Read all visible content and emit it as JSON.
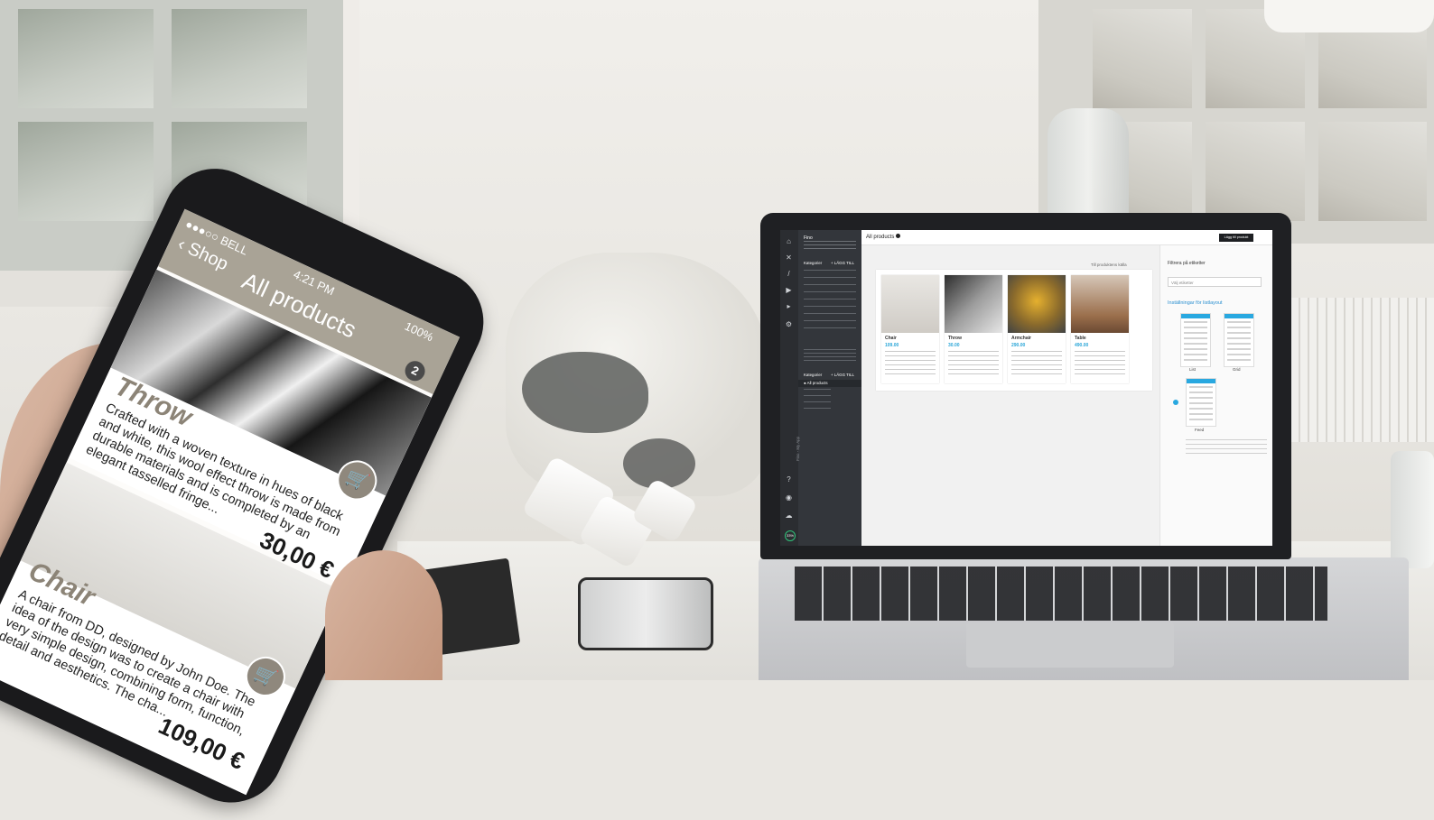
{
  "phone_app": {
    "status": {
      "carrier": "●●●○○ BELL",
      "time": "4:21 PM",
      "battery": "100%"
    },
    "back_label": "Shop",
    "title": "All products",
    "cart_count": "2",
    "products": [
      {
        "name": "Throw",
        "description": "Crafted with a woven texture in hues of black and white, this wool effect throw is made from durable materials and is completed by an elegant tasselled fringe...",
        "price": "30,00 €"
      },
      {
        "name": "Chair",
        "description": "A chair from DD, designed by John Doe. The idea of the design was to create a chair with very simple design, combining form, function, detail and aesthetics. The cha...",
        "price": "109,00 €"
      }
    ]
  },
  "laptop_app": {
    "page_title": "All products",
    "header_button": "Lägg till produkt",
    "sidebar": {
      "shop_title": "Fino",
      "section_categories": "Kategorier",
      "add_label": "+ LÄGG TILL",
      "active_item": "All products",
      "side_text": "Fino - My App",
      "progress": "33%"
    },
    "content_link": "Till produktens källa",
    "cards": [
      {
        "name": "Chair",
        "price": "109.00"
      },
      {
        "name": "Throw",
        "price": "30.00"
      },
      {
        "name": "Armchair",
        "price": "290.00"
      },
      {
        "name": "Table",
        "price": "490.00"
      }
    ],
    "right_panel": {
      "filter_heading": "Filtrera på etiketter",
      "filter_placeholder": "Välj etiketter",
      "layout_heading": "Inställningar för listlayout",
      "layout_options": [
        "List",
        "Grid",
        "Feed"
      ]
    }
  }
}
